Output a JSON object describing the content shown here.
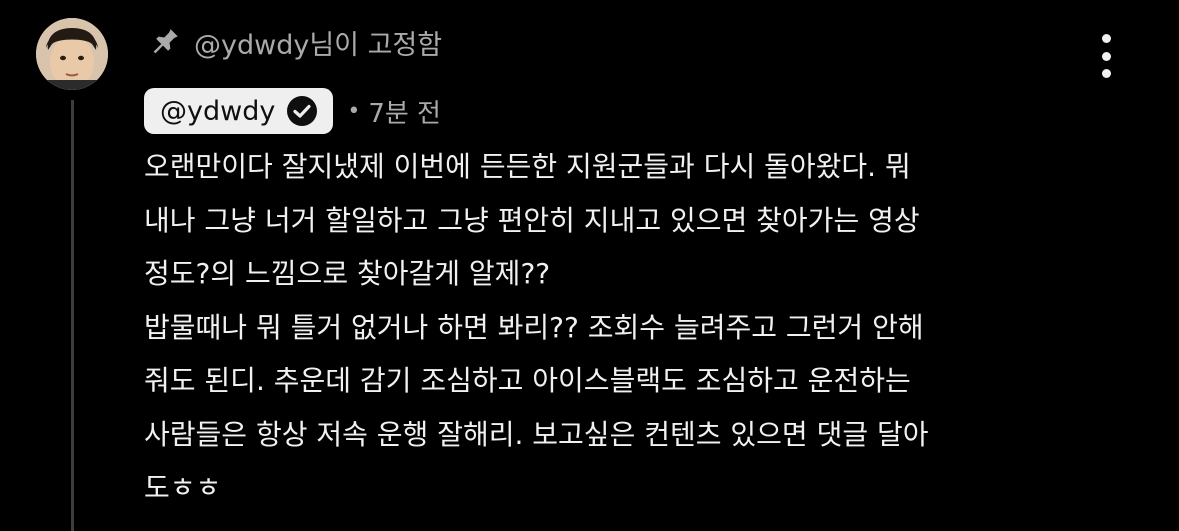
{
  "comment": {
    "pinned_label": "@ydwdy님이 고정함",
    "author": "@ydwdy",
    "timestamp_separator": "•",
    "timestamp": "7분 전",
    "body_lines": [
      "오랜만이다 잘지냈제 이번에 든든한 지원군들과 다시 돌아왔다. 뭐",
      "내나 그냥 너거 할일하고 그냥 편안히 지내고 있으면 찾아가는 영상",
      "정도?의 느낌으로 찾아갈게 알제??",
      "밥물때나 뭐 틀거 없거나 하면 봐리?? 조회수 늘려주고 그런거 안해",
      "줘도 된디. 추운데 감기 조심하고 아이스블랙도 조심하고 운전하는",
      "사람들은 항상 저속 운행 잘해리. 보고싶은 컨텐츠 있으면 댓글 달아",
      "도ㅎㅎ"
    ]
  },
  "icons": {
    "pin": "pin-icon",
    "verified": "verified-check-icon",
    "more": "more-vertical-icon",
    "avatar": "avatar"
  },
  "colors": {
    "background": "#000000",
    "text_primary": "#f1f1f1",
    "text_secondary": "#aaaaaa",
    "chip_background": "#efefef",
    "chip_text": "#0f0f0f"
  }
}
